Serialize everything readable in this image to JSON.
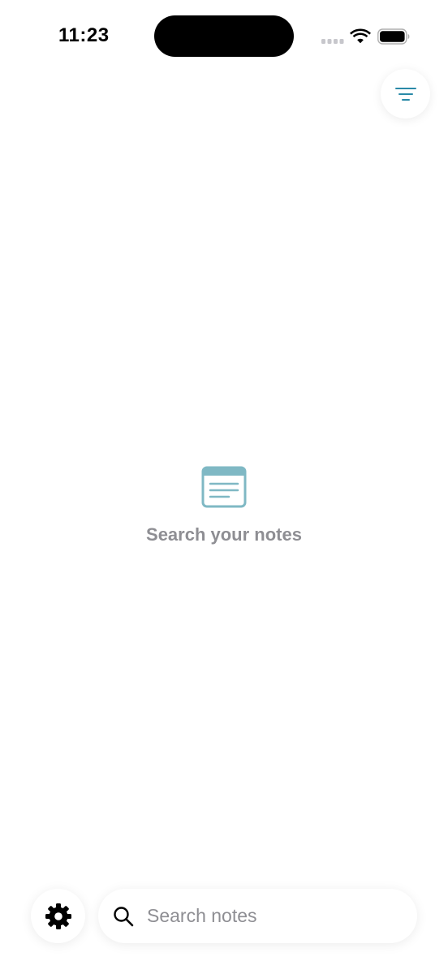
{
  "status_bar": {
    "time": "11:23"
  },
  "header": {
    "filter_icon": "filter-lines-icon"
  },
  "empty_state": {
    "icon": "notes-icon",
    "message": "Search your notes"
  },
  "bottom_bar": {
    "settings_icon": "gear-icon",
    "search": {
      "icon": "search-icon",
      "placeholder": "Search notes",
      "value": ""
    }
  },
  "colors": {
    "accent": "#2a8aa8",
    "icon_teal": "#7fb8c4",
    "secondary_text": "#8e8e93",
    "background": "#ffffff"
  }
}
